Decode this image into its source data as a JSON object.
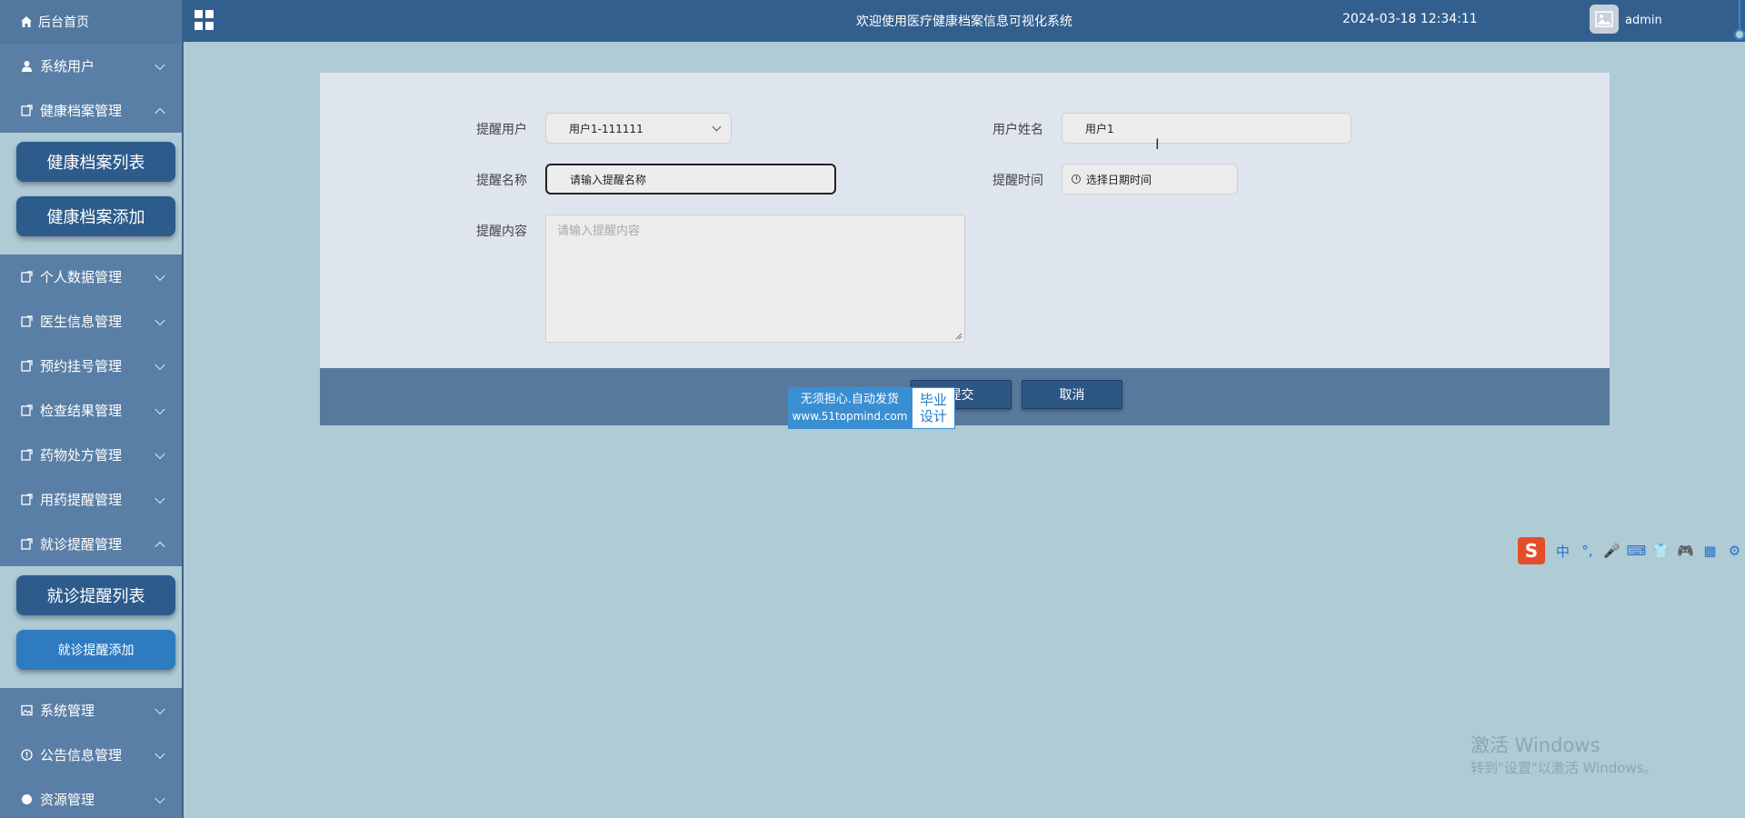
{
  "sidebar": {
    "home_label": "后台首页",
    "items": [
      {
        "label": "系统用户",
        "icon": "user-icon",
        "expanded": false
      },
      {
        "label": "健康档案管理",
        "icon": "doc-icon",
        "expanded": true
      },
      {
        "label": "个人数据管理",
        "icon": "doc-icon",
        "expanded": false
      },
      {
        "label": "医生信息管理",
        "icon": "doc-icon",
        "expanded": false
      },
      {
        "label": "预约挂号管理",
        "icon": "doc-icon",
        "expanded": false
      },
      {
        "label": "检查结果管理",
        "icon": "doc-icon",
        "expanded": false
      },
      {
        "label": "药物处方管理",
        "icon": "doc-icon",
        "expanded": false
      },
      {
        "label": "用药提醒管理",
        "icon": "doc-icon",
        "expanded": false
      },
      {
        "label": "就诊提醒管理",
        "icon": "doc-icon",
        "expanded": true
      },
      {
        "label": "系统管理",
        "icon": "image-icon",
        "expanded": false
      },
      {
        "label": "公告信息管理",
        "icon": "info-icon",
        "expanded": false
      },
      {
        "label": "资源管理",
        "icon": "doc-icon",
        "expanded": false
      }
    ],
    "health_sub": [
      "健康档案列表",
      "健康档案添加"
    ],
    "visit_sub": [
      "就诊提醒列表",
      "就诊提醒添加"
    ]
  },
  "header": {
    "welcome": "欢迎使用医疗健康档案信息可视化系统",
    "datetime": "2024-03-18 12:34:11",
    "user": "admin"
  },
  "form": {
    "remind_user_label": "提醒用户",
    "remind_user_value": "用户1-111111",
    "user_name_label": "用户姓名",
    "user_name_value": "用户1",
    "remind_name_label": "提醒名称",
    "remind_name_value": "请输入提醒名称",
    "remind_time_label": "提醒时间",
    "remind_time_placeholder": "选择日期时间",
    "remind_content_label": "提醒内容",
    "remind_content_placeholder": "请输入提醒内容"
  },
  "actions": {
    "submit": "提交",
    "cancel": "取消"
  },
  "ad": {
    "line1": "无须担心.自动发货",
    "url": "www.51topmind.com",
    "tag1": "毕业",
    "tag2": "设计"
  },
  "ime": {
    "logo": "S",
    "glyphs": [
      "中",
      "°,",
      "🎤",
      "⌨",
      "👕",
      "🎮",
      "▦",
      "⚙"
    ]
  },
  "windows": {
    "line1": "激活 Windows",
    "line2": "转到\"设置\"以激活 Windows。"
  },
  "colors": {
    "sidebar": "#5a7fa6",
    "header": "#335f8e",
    "background": "#aecbd6",
    "button": "#2e5684",
    "active_sub": "#2f7bbf"
  }
}
